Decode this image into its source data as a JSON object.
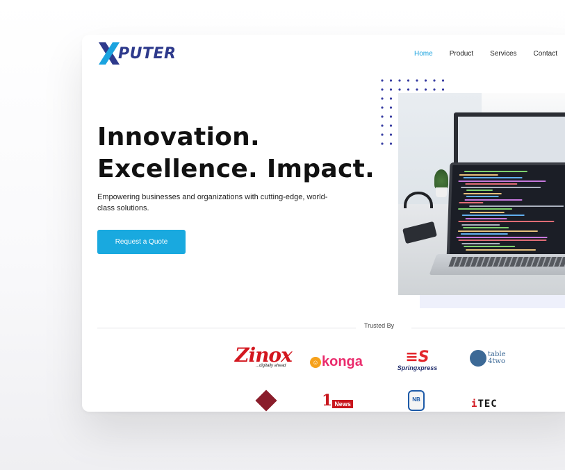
{
  "brand": {
    "logo_mark": "X",
    "logo_text": "PUTER"
  },
  "nav": {
    "items": [
      {
        "label": "Home",
        "active": true
      },
      {
        "label": "Product"
      },
      {
        "label": "Services"
      },
      {
        "label": "Contact"
      }
    ]
  },
  "hero": {
    "title_line1": "Innovation.",
    "title_line2": "Excellence. Impact.",
    "subtitle": "Empowering businesses and organizations with cutting-edge, world-class solutions.",
    "cta_label": "Request a Quote"
  },
  "trusted": {
    "label": "Trusted By",
    "logos": {
      "zinox": {
        "word": "Zinox",
        "tagline": "...digitally ahead"
      },
      "konga": {
        "word": "konga"
      },
      "springxpress": {
        "word": "Springxpress"
      },
      "table4two": {
        "word_top": "table",
        "word_bottom": "4two"
      },
      "news1": {
        "number": "1",
        "word": "News"
      },
      "nb": {
        "word": "NB"
      },
      "itec": {
        "first": "i",
        "rest": "TEC"
      }
    }
  },
  "colors": {
    "accent": "#19a9df",
    "brand_blue": "#2e3a8c",
    "dots": "#3a3fa3"
  }
}
